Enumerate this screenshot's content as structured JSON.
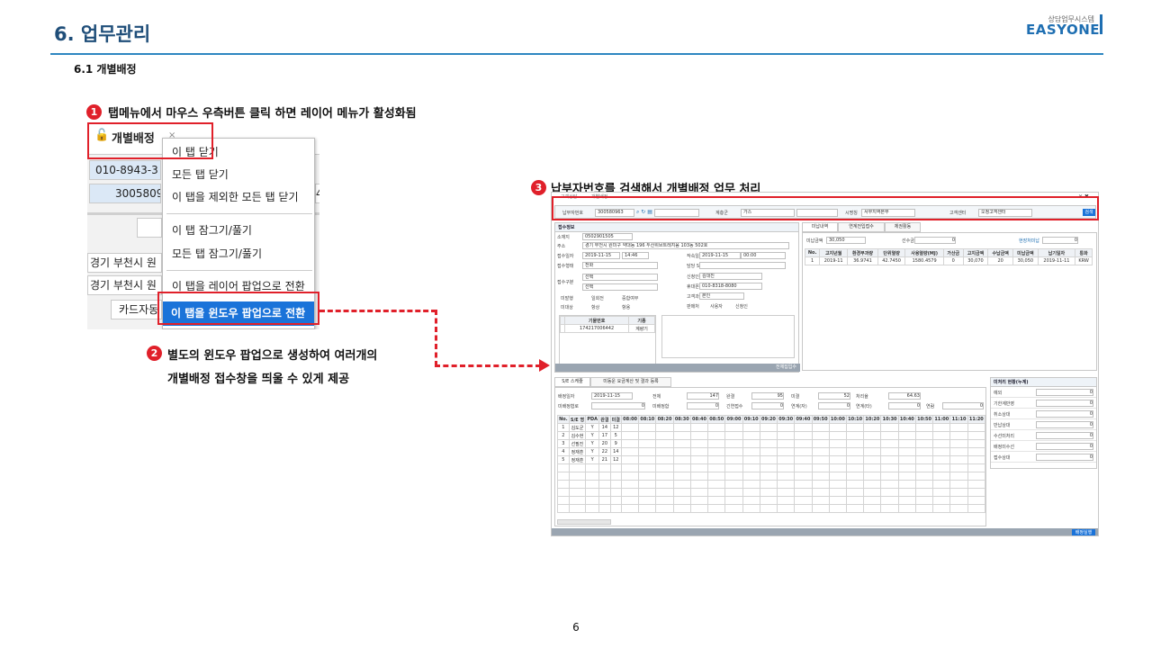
{
  "header": {
    "title": "6. 업무관리",
    "brand_sub": "상담업무시스템",
    "brand": "EASYONE"
  },
  "section": {
    "subtitle": "6.1 개별배정"
  },
  "steps": [
    {
      "num": "1",
      "text": "탭메뉴에서 마우스 우측버튼 클릭 하면 레이어 메뉴가 활성화됨"
    },
    {
      "num": "2",
      "line1": "별도의 윈도우 팝업으로 생성하여 여러개의",
      "line2": "개별배정 접수창을 띄울 수 있게 제공"
    },
    {
      "num": "3",
      "text": "납부자번호를 검색해서 개별배정 업무 처리"
    }
  ],
  "crop1": {
    "tab_label": "개별배정",
    "tab_lock": "🔓",
    "tab_x": "×",
    "rows": [
      "010-8943-3",
      "3005809",
      "경기 부천시 원",
      "경기 부천시 원",
      "카드자동"
    ],
    "row_tail": "4",
    "menu": {
      "items": [
        "이 탭 닫기",
        "모든 탭 닫기",
        "이 탭을 제외한 모든 탭 닫기",
        "이 탭 잠그기/풀기",
        "모든 탭 잠그기/풀기",
        "이 탭을 레이어 팝업으로 전환"
      ],
      "selected": "이 탭을 윈도우 팝업으로 전환"
    }
  },
  "crop2": {
    "top_tabs": [
      "고객상담",
      "개별배정"
    ],
    "close": "× ✖",
    "search": {
      "payer_label": "납부자번호",
      "payer_value": "300580963",
      "service_label": "계층군",
      "service_value": "가스",
      "city_label": "시명칭",
      "city_value": "서부지역본부",
      "center_label": "고객센터",
      "center_value": "오정고객센터",
      "btn": "검색"
    },
    "receipt": {
      "head": "접수정보",
      "fields": [
        {
          "label": "소재지",
          "value": "0502901505"
        },
        {
          "label": "주소",
          "value": "경기 부천시 원미구 약대동 196 두산위브트레지움 103동 502호"
        },
        {
          "label": "접수일자",
          "value": "2019-11-15"
        },
        {
          "label": "접수형태",
          "value": "전화"
        },
        {
          "label": "접수구분",
          "value": "선택"
        },
        {
          "label": "",
          "value": "선택"
        }
      ],
      "time_value": "14:46",
      "right_fields": [
        {
          "label": "작속일시",
          "value": "2019-11-15"
        },
        {
          "label": "담당 S/E",
          "value": ""
        },
        {
          "label": "신청인명",
          "value": "김대진"
        },
        {
          "label": "휴대폰번호",
          "value": "010-8318-8080"
        },
        {
          "label": "고객과의 관계",
          "value": "본인"
        },
        {
          "label": "판매처",
          "value": ""
        }
      ],
      "right_time": "00:00",
      "radio_opts": [
        "사용자",
        "신청인"
      ],
      "checks": [
        "미발행",
        "일회전",
        "중합여부"
      ],
      "radios2": [
        "미대상",
        "항상",
        "항용"
      ],
      "meter_table": {
        "headers": [
          "기물번호",
          "기종"
        ],
        "rows": [
          [
            "174217006442",
            "계량기"
          ]
        ]
      },
      "save_btn": "전체집입수"
    },
    "billing": {
      "tabs": [
        "미납내역",
        "연계전입접수",
        "체권활동"
      ],
      "summary": [
        {
          "label": "미납금액",
          "value": "30,050"
        },
        {
          "label": "선수금",
          "value": "0"
        },
        {
          "label": "현장처미납",
          "value": "0"
        }
      ],
      "headers": [
        "No.",
        "고지년월",
        "환경부과량",
        "단위열량",
        "사용열량(MJ)",
        "가산금",
        "고지금액",
        "수납금액",
        "미납금액",
        "납기일자",
        "통화"
      ],
      "rows": [
        [
          "1",
          "2019-11",
          "36.9741",
          "42.7450",
          "1580.4579",
          "0",
          "30,070",
          "20",
          "30,050",
          "2019-11-11",
          "KRW"
        ]
      ]
    },
    "schedule": {
      "tabs": [
        "S/E 스케줄",
        "미동운 요금계산 및 결과 등록"
      ],
      "date_label": "배정일자",
      "date_value": "2019-11-15",
      "stats": [
        {
          "label": "전체",
          "value": "147"
        },
        {
          "label": "완결",
          "value": "95"
        },
        {
          "label": "미결",
          "value": "52"
        },
        {
          "label": "처리율",
          "value": "64.63"
        }
      ],
      "stats2": [
        {
          "label": "미배정협로",
          "value": "0"
        },
        {
          "label": "미배정합",
          "value": "0"
        },
        {
          "label": "긴연접수",
          "value": "0"
        },
        {
          "label": "연계(자)",
          "value": "0"
        },
        {
          "label": "연계(타)",
          "value": "0"
        },
        {
          "label": "연람",
          "value": "0"
        }
      ],
      "headers": [
        "No.",
        "S/E 명",
        "PDA",
        "완결",
        "미결",
        "08:00",
        "08:10",
        "08:20",
        "08:30",
        "08:40",
        "08:50",
        "09:00",
        "09:10",
        "09:20",
        "09:30",
        "09:40",
        "09:50",
        "10:00",
        "10:10",
        "10:20",
        "10:30",
        "10:40",
        "10:50",
        "11:00",
        "11:10",
        "11:20"
      ],
      "rows": [
        [
          "1",
          "김도균",
          "Y",
          "14",
          "12"
        ],
        [
          "2",
          "김수현",
          "Y",
          "17",
          "5"
        ],
        [
          "3",
          "선필진",
          "Y",
          "20",
          "9"
        ],
        [
          "4",
          "정재훈",
          "Y",
          "22",
          "14"
        ],
        [
          "5",
          "정재훈",
          "Y",
          "21",
          "12"
        ]
      ],
      "assign_btn": "배정실행"
    },
    "pending": {
      "head": "미처리 현황(누계)",
      "rows": [
        {
          "label": "예외",
          "value": "0"
        },
        {
          "label": "기한계반영",
          "value": "0"
        },
        {
          "label": "취소상대",
          "value": "0"
        },
        {
          "label": "반납상대",
          "value": "0"
        },
        {
          "label": "수선미처리",
          "value": "0"
        },
        {
          "label": "배정미수선",
          "value": "0"
        },
        {
          "label": "접수상대",
          "value": "0"
        }
      ]
    }
  },
  "page": {
    "number": "6"
  }
}
